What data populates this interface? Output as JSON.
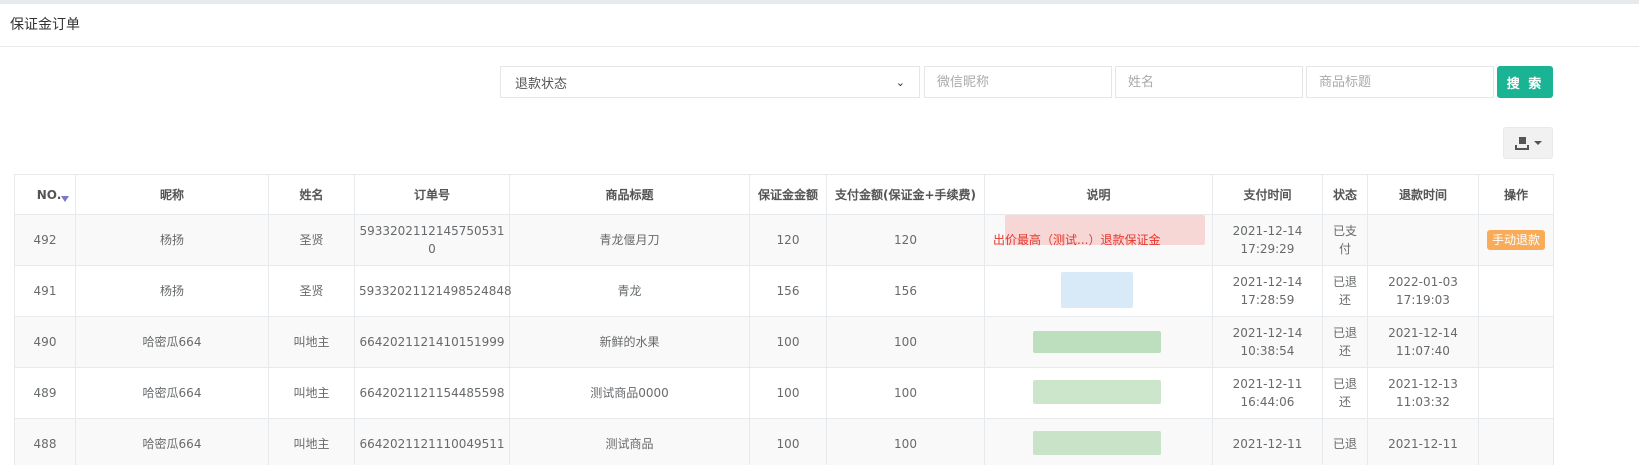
{
  "page": {
    "title": "保证金订单"
  },
  "search": {
    "refund_status_label": "退款状态",
    "wechat_nickname_placeholder": "微信昵称",
    "name_placeholder": "姓名",
    "product_title_placeholder": "商品标题",
    "search_button_label": "搜 索"
  },
  "table": {
    "headers": [
      "NO.",
      "昵称",
      "姓名",
      "订单号",
      "商品标题",
      "保证金金额",
      "支付金额(保证金+手续费)",
      "说明",
      "支付时间",
      "状态",
      "退款时间",
      "操作"
    ],
    "rows": [
      {
        "no": "492",
        "nickname": "杨扬",
        "name": "圣贤",
        "order_no": "5933202112145750531​0",
        "product": "青龙偃月刀",
        "deposit": "120",
        "paid": "120",
        "description": "出价最高（测试...）退款保证金",
        "pay_time": "2021-12-14 17:29:29",
        "status": "已支付",
        "refund_time": "",
        "action": "手动退款"
      },
      {
        "no": "491",
        "nickname": "杨扬",
        "name": "圣贤",
        "order_no": "59332021121498524848",
        "product": "青龙",
        "deposit": "156",
        "paid": "156",
        "description": "",
        "pay_time": "2021-12-14 17:28:59",
        "status": "已退还",
        "refund_time": "2022-01-03 17:19:03",
        "action": ""
      },
      {
        "no": "490",
        "nickname": "哈密瓜664",
        "name": "叫地主",
        "order_no": "6642021121410151999",
        "product": "新鲜的水果",
        "deposit": "100",
        "paid": "100",
        "description": "",
        "pay_time": "2021-12-14 10:38:54",
        "status": "已退还",
        "refund_time": "2021-12-14 11:07:40",
        "action": ""
      },
      {
        "no": "489",
        "nickname": "哈密瓜664",
        "name": "叫地主",
        "order_no": "6642021121154485598",
        "product": "测试商品0000",
        "deposit": "100",
        "paid": "100",
        "description": "",
        "pay_time": "2021-12-11 16:44:06",
        "status": "已退还",
        "refund_time": "2021-12-13 11:03:32",
        "action": ""
      },
      {
        "no": "488",
        "nickname": "哈密瓜664",
        "name": "叫地主",
        "order_no": "6642021121110049511",
        "product": "测试商品",
        "deposit": "100",
        "paid": "100",
        "description": "",
        "pay_time": "2021-12-11",
        "status": "已退",
        "refund_time": "2021-12-11",
        "action": ""
      }
    ]
  },
  "colors": {
    "primary": "#1ab394",
    "warning": "#f8ac59",
    "alert_text": "#e8352b",
    "sort_indicator": "#7a76c9"
  },
  "icons": {
    "export": "export-icon",
    "sort": "sort-desc-icon"
  }
}
